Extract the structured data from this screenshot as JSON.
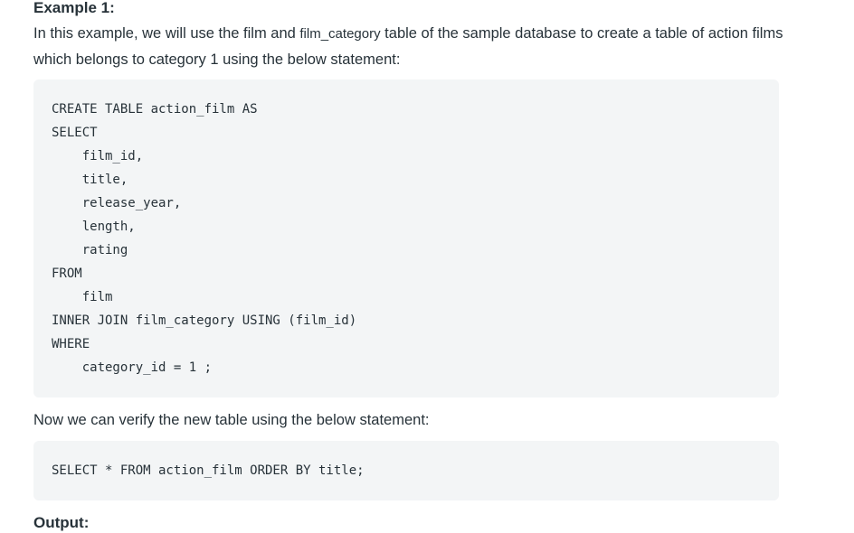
{
  "example_heading": "Example 1:",
  "intro": {
    "before": "In this example, we will use the film and ",
    "inline_code": "film_category",
    "after": " table of the sample database to create a table of action films which belongs to category 1 using the below statement:"
  },
  "code_block_1": {
    "lines": [
      "CREATE TABLE action_film AS",
      "SELECT",
      "    film_id,",
      "    title,",
      "    release_year,",
      "    length,",
      "    rating",
      "FROM",
      "    film",
      "INNER JOIN film_category USING (film_id)",
      "WHERE",
      "    category_id = 1 ;"
    ]
  },
  "verify_text": "Now we can verify the new table using the below statement:",
  "code_block_2": {
    "lines": [
      "SELECT * FROM action_film ORDER BY title;"
    ]
  },
  "output_heading": "Output:"
}
